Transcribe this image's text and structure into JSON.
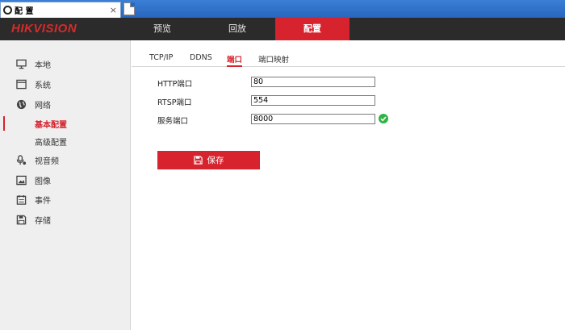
{
  "browser": {
    "tab_title": "配 置",
    "close_glyph": "×"
  },
  "header": {
    "logo_text": "HIKVISION",
    "nav": [
      "预览",
      "回放",
      "配置"
    ],
    "active_nav": "配置"
  },
  "sidebar": {
    "items": [
      {
        "label": "本地",
        "icon": "monitor-icon"
      },
      {
        "label": "系统",
        "icon": "window-icon"
      },
      {
        "label": "网络",
        "icon": "globe-icon"
      },
      {
        "label": "基本配置",
        "sub": true,
        "active": true
      },
      {
        "label": "高级配置",
        "sub": true
      },
      {
        "label": "视音频",
        "icon": "microphone-icon"
      },
      {
        "label": "图像",
        "icon": "image-icon"
      },
      {
        "label": "事件",
        "icon": "calendar-icon"
      },
      {
        "label": "存储",
        "icon": "floppy-icon"
      }
    ]
  },
  "subtabs": [
    "TCP/IP",
    "DDNS",
    "端口",
    "端口映射"
  ],
  "active_subtab": "端口",
  "form": {
    "http_label": "HTTP端口",
    "http_value": "80",
    "rtsp_label": "RTSP端口",
    "rtsp_value": "554",
    "service_label": "服务端口",
    "service_value": "8000"
  },
  "save_label": "保存",
  "colors": {
    "accent": "#d6232e",
    "header_bg": "#2b2b2b",
    "sidebar_bg": "#efefef",
    "valid_green": "#2fb344"
  }
}
